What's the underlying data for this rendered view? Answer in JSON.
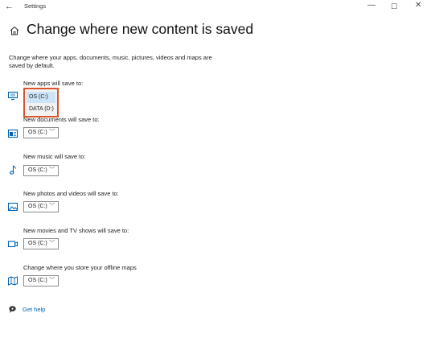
{
  "titlebar": {
    "back": "←",
    "title": "Settings",
    "minimize": "—",
    "maximize": "☐",
    "close": "✕"
  },
  "page": {
    "title": "Change where new content is saved",
    "description": "Change where your apps, documents, music, pictures, videos and maps are saved by default."
  },
  "colors": {
    "accent": "#0063b1",
    "highlight_border": "#d9532c",
    "selected_option": "#cce4f7"
  },
  "rows": [
    {
      "label": "New apps will save to:",
      "value": "OS (C:)",
      "icon": "monitor-icon",
      "expanded": true
    },
    {
      "label": "New documents will save to:",
      "value": "OS (C:)",
      "icon": "documents-icon"
    },
    {
      "label": "New music will save to:",
      "value": "OS (C:)",
      "icon": "music-note-icon"
    },
    {
      "label": "New photos and videos will save to:",
      "value": "OS (C:)",
      "icon": "photo-icon"
    },
    {
      "label": "New movies and TV shows will save to:",
      "value": "OS (C:)",
      "icon": "video-camera-icon"
    },
    {
      "label": "Change where you store your offline maps",
      "value": "OS (C:)",
      "icon": "map-icon"
    }
  ],
  "apps_dropdown": {
    "options": [
      "OS (C:)",
      "DATA (D:)"
    ],
    "selected": "OS (C:)"
  },
  "chevron": "﹀",
  "help": {
    "label": "Get help"
  }
}
